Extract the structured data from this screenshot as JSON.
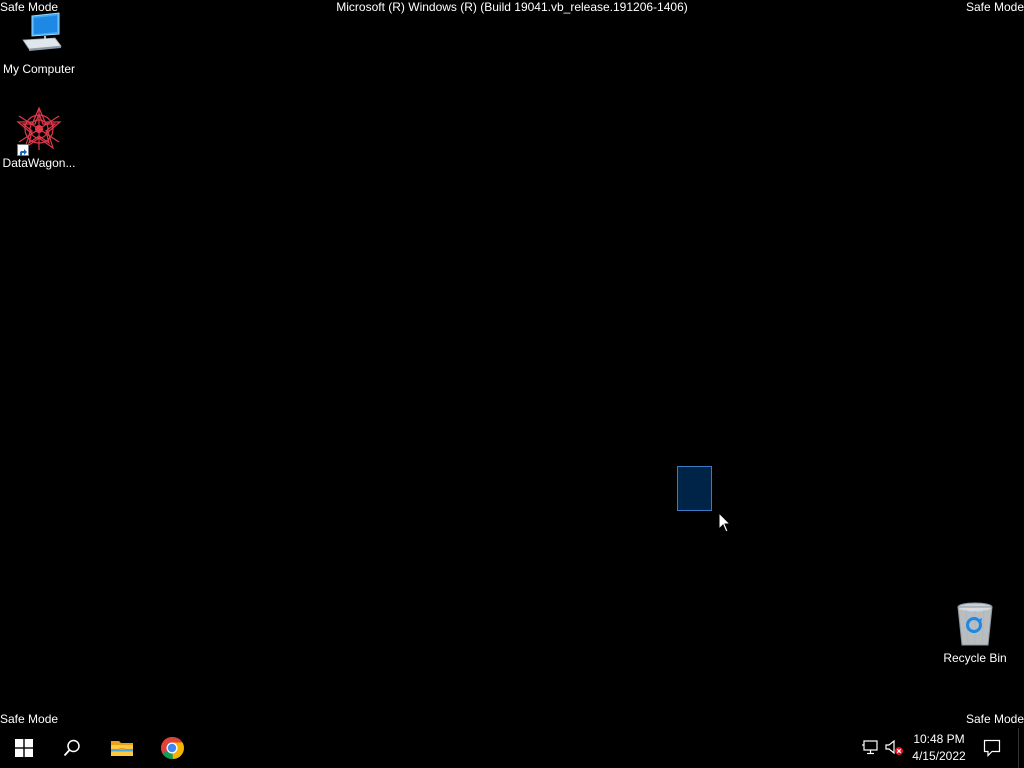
{
  "overlay": {
    "safe_mode_top_left": "Safe Mode",
    "safe_mode_top_right": "Safe Mode",
    "safe_mode_bottom_left": "Safe Mode",
    "safe_mode_bottom_right": "Safe Mode",
    "build_banner": "Microsoft (R) Windows (R) (Build 19041.vb_release.191206-1406)"
  },
  "desktop_icons": [
    {
      "label": "My Computer",
      "icon": "computer-icon"
    },
    {
      "label": "DataWagon...",
      "icon": "datawagon-app-icon",
      "shortcut": true
    },
    {
      "label": "Recycle Bin",
      "icon": "recycle-bin-icon"
    }
  ],
  "taskbar": {
    "buttons": [
      {
        "icon": "windows-start-icon"
      },
      {
        "icon": "search-icon"
      },
      {
        "icon": "file-explorer-icon"
      },
      {
        "icon": "chrome-icon"
      }
    ],
    "tray": {
      "network_icon": "network-disconnected-icon",
      "volume_icon": "volume-muted-icon",
      "time": "10:48 PM",
      "date": "4/15/2022",
      "notification_icon": "action-center-icon"
    }
  },
  "colors": {
    "desktop_background": "#000000",
    "selection_fill": "#0a2a52",
    "selection_border": "#3a7cc4",
    "text": "#ffffff"
  }
}
